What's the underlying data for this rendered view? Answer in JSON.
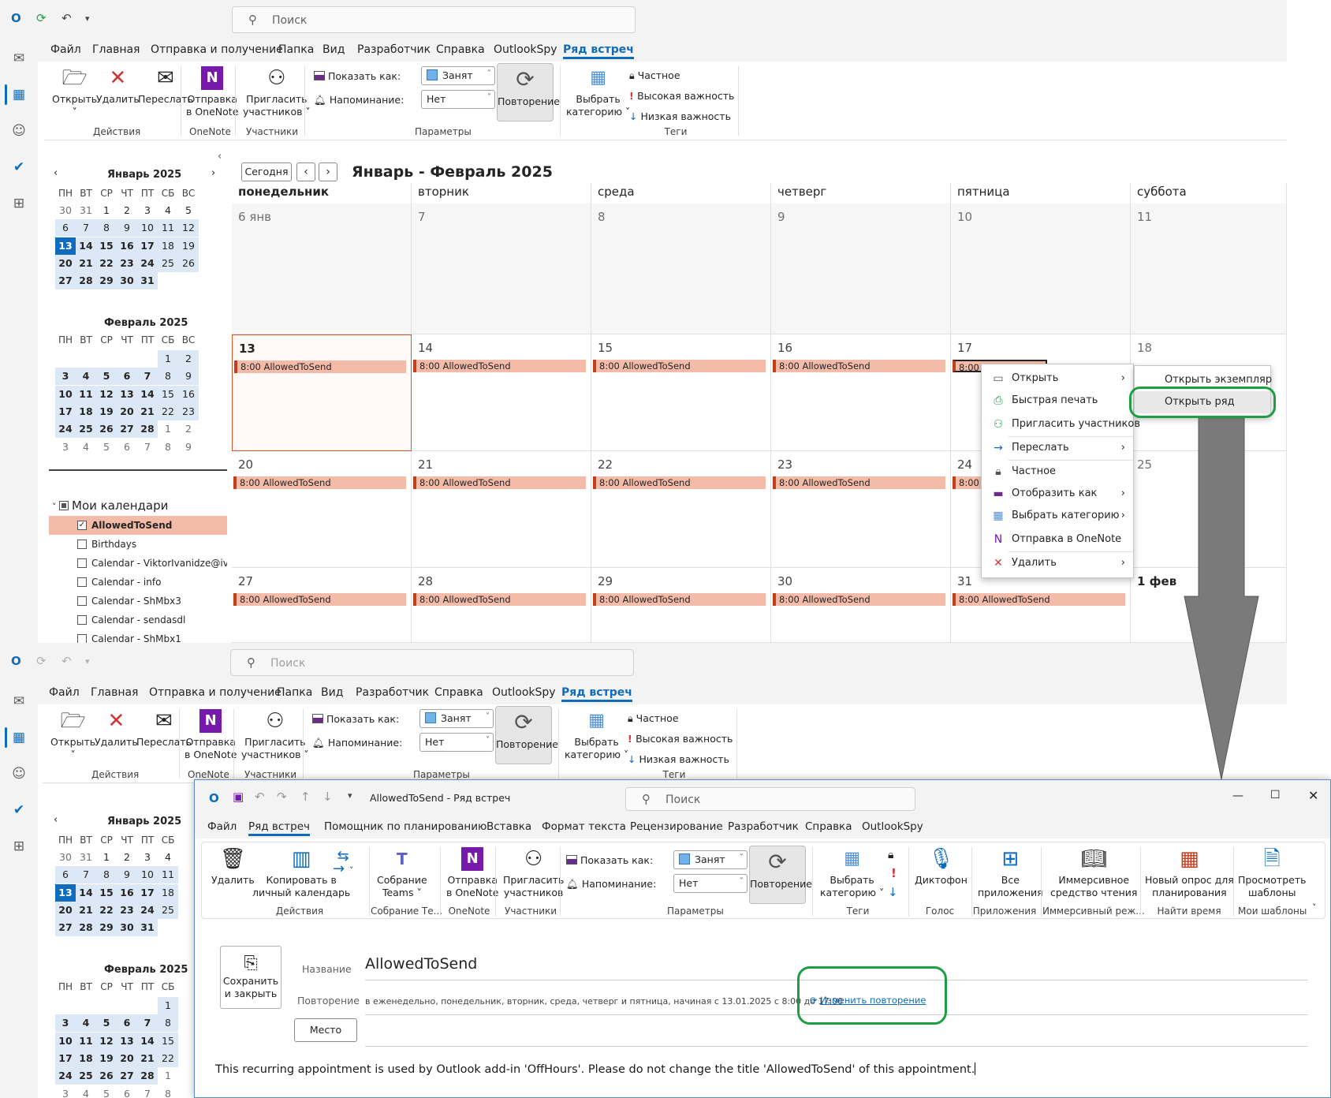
{
  "app": {
    "search_placeholder": "Поиск",
    "menu": [
      "Файл",
      "Главная",
      "Отправка и получение",
      "Папка",
      "Вид",
      "Разработчик",
      "Справка",
      "OutlookSpy",
      "Ряд встреч"
    ],
    "ribbon": {
      "open": "Открыть",
      "delete": "Удалить",
      "forward": "Переслать",
      "group_actions": "Действия",
      "onenote_l1": "Отправка",
      "onenote_l2": "в OneNote",
      "group_onenote": "OneNote",
      "invite_l1": "Пригласить",
      "invite_l2": "участников ˅",
      "group_attendees": "Участники",
      "show_as_label": "Показать как:",
      "show_as_value": "Занят",
      "reminder_label": "Напоминание:",
      "reminder_value": "Нет",
      "recurrence": "Повторение",
      "group_options": "Параметры",
      "category_l1": "Выбрать",
      "category_l2": "категорию ˅",
      "private": "Частное",
      "high": "Высокая важность",
      "low": "Низкая важность",
      "group_tags": "Теги"
    }
  },
  "minical": {
    "jan_title": "Январь 2025",
    "feb_title": "Февраль 2025",
    "dow": [
      "ПН",
      "ВТ",
      "СР",
      "ЧТ",
      "ПТ",
      "СБ",
      "ВС"
    ],
    "jan_days": [
      [
        "30",
        "31",
        "1",
        "2",
        "3",
        "4",
        "5"
      ],
      [
        "6",
        "7",
        "8",
        "9",
        "10",
        "11",
        "12"
      ],
      [
        "13",
        "14",
        "15",
        "16",
        "17",
        "18",
        "19"
      ],
      [
        "20",
        "21",
        "22",
        "23",
        "24",
        "25",
        "26"
      ],
      [
        "27",
        "28",
        "29",
        "30",
        "31",
        "",
        ""
      ]
    ],
    "feb_days": [
      [
        "",
        "",
        "",
        "",
        "",
        "1",
        "2"
      ],
      [
        "3",
        "4",
        "5",
        "6",
        "7",
        "8",
        "9"
      ],
      [
        "10",
        "11",
        "12",
        "13",
        "14",
        "15",
        "16"
      ],
      [
        "17",
        "18",
        "19",
        "20",
        "21",
        "22",
        "23"
      ],
      [
        "24",
        "25",
        "26",
        "27",
        "28",
        "1",
        "2"
      ],
      [
        "3",
        "4",
        "5",
        "6",
        "7",
        "8",
        "9"
      ]
    ]
  },
  "calendars": {
    "header": "Мои календари",
    "items": [
      "AllowedToSend",
      "Birthdays",
      "Calendar - ViktorIvanidze@iv...",
      "Calendar - info",
      "Calendar - ShMbx3",
      "Calendar - sendasdl",
      "Calendar - ShMbx1"
    ]
  },
  "calendar": {
    "today_btn": "Сегодня",
    "range_title": "Январь - Февраль 2025",
    "days": [
      "понедельник",
      "вторник",
      "среда",
      "четверг",
      "пятница",
      "суббота"
    ],
    "weeks": [
      [
        "6 янв",
        "7",
        "8",
        "9",
        "10",
        "11"
      ],
      [
        "13",
        "14",
        "15",
        "16",
        "17",
        "18"
      ],
      [
        "20",
        "21",
        "22",
        "23",
        "24",
        "25"
      ],
      [
        "27",
        "28",
        "29",
        "30",
        "31",
        "1 фев"
      ]
    ],
    "event": "8:00 AllowedToSend",
    "event_trunc1": "8:00 AllowedToSend",
    "event_trunc2": "8:00 A"
  },
  "context_menu": {
    "items": [
      "Открыть",
      "Быстрая печать",
      "Пригласить участников",
      "Переслать",
      "Частное",
      "Отобразить как",
      "Выбрать категорию",
      "Отправка в OneNote",
      "Удалить"
    ],
    "submenu": [
      "Открыть экземпляр",
      "Открыть ряд"
    ]
  },
  "window": {
    "title": "AllowedToSend  -  Ряд встреч",
    "search": "Поиск",
    "menu": [
      "Файл",
      "Ряд встреч",
      "Помощник по планированию",
      "Вставка",
      "Формат текста",
      "Рецензирование",
      "Разработчик",
      "Справка",
      "OutlookSpy"
    ],
    "ribbon": {
      "delete": "Удалить",
      "copy_l1": "Копировать в",
      "copy_l2": "личный календарь",
      "group_actions": "Действия",
      "teams_l1": "Собрание",
      "teams_l2": "Teams ˅",
      "group_teams": "Собрание Те...",
      "onenote_l1": "Отправка",
      "onenote_l2": "в OneNote",
      "group_onenote": "OneNote",
      "invite_l1": "Пригласить",
      "invite_l2": "участников",
      "group_attendees": "Участники",
      "show_as_label": "Показать как:",
      "show_as_value": "Занят",
      "reminder_label": "Напоминание:",
      "reminder_value": "Нет",
      "recurrence": "Повторение",
      "group_options": "Параметры",
      "category_l1": "Выбрать",
      "category_l2": "категорию ˅",
      "group_tags": "Теги",
      "dictate": "Диктофон",
      "group_voice": "Голос",
      "apps_l1": "Все",
      "apps_l2": "приложения",
      "group_apps": "Приложения",
      "reader_l1": "Иммерсивное",
      "reader_l2": "средство чтения",
      "group_reader": "Иммерсивный реж...",
      "poll_l1": "Новый опрос для",
      "poll_l2": "планирования",
      "group_poll": "Найти время",
      "templates_l1": "Просмотреть",
      "templates_l2": "шаблоны",
      "group_templates": "Мои шаблоны"
    },
    "save_l1": "Сохранить",
    "save_l2": "и закрыть",
    "name_label": "Название",
    "name_value": "AllowedToSend",
    "recur_label": "Повторение",
    "recur_value": "в еженедельно, понедельник, вторник, среда, четверг и пятница, начиная с 13.01.2025 с 8:00 до 17:00",
    "change_recur": "Изменить повторение",
    "location_btn": "Место",
    "body": "This recurring appointment is used by Outlook add-in 'OffHours'. Please do not change the title 'AllowedToSend' of this appointment."
  },
  "colors": {
    "accent": "#0f6cbd",
    "event_fill": "#f4bba9",
    "event_border": "#c43e1c",
    "highlight_green": "#1d9e43",
    "selected_calendar": "#f4bba9"
  }
}
